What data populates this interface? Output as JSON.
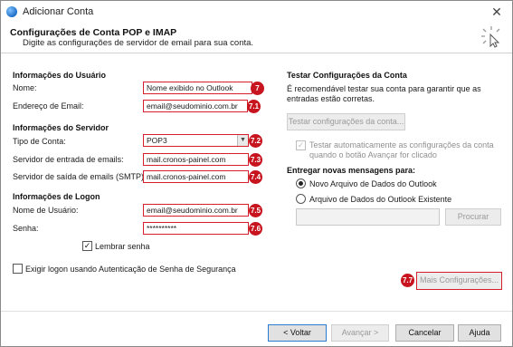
{
  "window": {
    "title": "Adicionar Conta",
    "close_glyph": "✕"
  },
  "header": {
    "title": "Configurações de Conta POP e IMAP",
    "subtitle": "Digite as configurações de servidor de email para sua conta."
  },
  "user_info": {
    "section": "Informações do Usuário",
    "name_label": "Nome:",
    "name_value": "Nome exibido no Outlook",
    "name_badge": "7",
    "email_label": "Endereço de Email:",
    "email_value": "email@seudominio.com.br",
    "email_badge": "7.1"
  },
  "server_info": {
    "section": "Informações do Servidor",
    "type_label": "Tipo de Conta:",
    "type_value": "POP3",
    "type_badge": "7.2",
    "incoming_label": "Servidor de entrada de emails:",
    "incoming_value": "mail.cronos-painel.com",
    "incoming_badge": "7.3",
    "outgoing_label": "Servidor de saída de emails (SMTP):",
    "outgoing_value": "mail.cronos-painel.com",
    "outgoing_badge": "7.4"
  },
  "logon_info": {
    "section": "Informações de Logon",
    "username_label": "Nome de Usuário:",
    "username_value": "email@seudominio.com.br",
    "username_badge": "7.5",
    "password_label": "Senha:",
    "password_value": "**********",
    "password_badge": "7.6",
    "remember_label": "Lembrar senha",
    "spa_label": "Exigir logon usando Autenticação de Senha de Segurança"
  },
  "test_section": {
    "title": "Testar Configurações da Conta",
    "description": "É recomendável testar sua conta para garantir que as entradas estão corretas.",
    "test_button": "Testar configurações da conta...",
    "auto_test_label": "Testar automaticamente as configurações da conta quando o botão Avançar for clicado"
  },
  "deliver_section": {
    "title": "Entregar novas mensagens para:",
    "option_new": "Novo Arquivo de Dados do Outlook",
    "option_existing": "Arquivo de Dados do Outlook Existente",
    "browse_button": "Procurar"
  },
  "more_settings": {
    "label": "Mais Configurações...",
    "badge": "7.7"
  },
  "footer": {
    "back": "< Voltar",
    "next": "Avançar >",
    "cancel": "Cancelar",
    "help": "Ajuda"
  },
  "colors": {
    "highlight": "#d4202a",
    "badge": "#c8141e",
    "accent": "#2a7bd4"
  }
}
